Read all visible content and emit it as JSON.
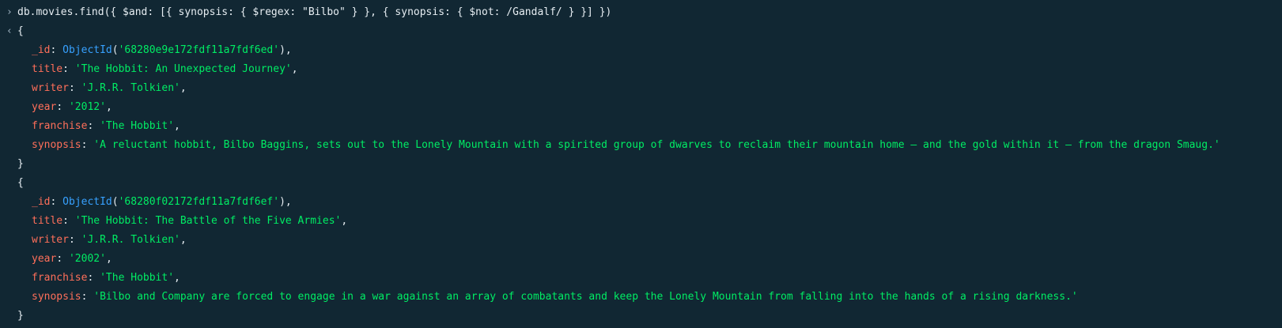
{
  "console": {
    "command": "db.movies.find({ $and: [{ synopsis: { $regex: \"Bilbo\" } }, { synopsis: { $not: /Gandalf/ } }] })",
    "prompt_symbol": "›",
    "result_symbol": "‹",
    "open_brace": "{",
    "close_brace": "}",
    "results": [
      {
        "id_key": "_id",
        "id_func": "ObjectId",
        "id_value": "'68280e9e172fdf11a7fdf6ed'",
        "title_key": "title",
        "title_value": "'The Hobbit: An Unexpected Journey'",
        "writer_key": "writer",
        "writer_value": "'J.R.R. Tolkien'",
        "year_key": "year",
        "year_value": "'2012'",
        "franchise_key": "franchise",
        "franchise_value": "'The Hobbit'",
        "synopsis_key": "synopsis",
        "synopsis_value": "'A reluctant hobbit, Bilbo Baggins, sets out to the Lonely Mountain with a spirited group of dwarves to reclaim their mountain home – and the gold within it – from the dragon Smaug.'"
      },
      {
        "id_key": "_id",
        "id_func": "ObjectId",
        "id_value": "'68280f02172fdf11a7fdf6ef'",
        "title_key": "title",
        "title_value": "'The Hobbit: The Battle of the Five Armies'",
        "writer_key": "writer",
        "writer_value": "'J.R.R. Tolkien'",
        "year_key": "year",
        "year_value": "'2002'",
        "franchise_key": "franchise",
        "franchise_value": "'The Hobbit'",
        "synopsis_key": "synopsis",
        "synopsis_value": "'Bilbo and Company are forced to engage in a war against an array of combatants and keep the Lonely Mountain from falling into the hands of a rising darkness.'"
      }
    ]
  },
  "colors": {
    "background": "#112733",
    "key": "#ff6f5a",
    "string": "#00ed64",
    "objectid": "#37a1ff",
    "default": "#e6edf2"
  }
}
